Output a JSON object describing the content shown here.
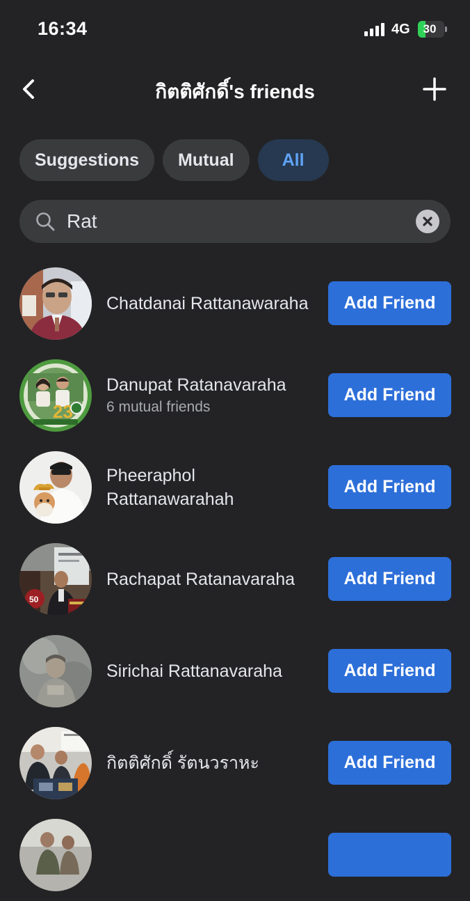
{
  "status_bar": {
    "time": "16:34",
    "network": "4G",
    "battery": "30",
    "battery_level": 0.3,
    "battery_color": "#30d158"
  },
  "nav": {
    "back_icon": "chevron-left-icon",
    "title": "กิตติศักดิ์'s friends",
    "add_icon": "plus-icon"
  },
  "tabs": [
    {
      "label": "Suggestions",
      "active": false
    },
    {
      "label": "Mutual",
      "active": false
    },
    {
      "label": "All",
      "active": true
    }
  ],
  "search": {
    "value": "Rat",
    "icon": "search-icon",
    "clear_icon": "close-circle-icon"
  },
  "friends": [
    {
      "name": "Chatdanai Rattanawaraha",
      "sub": "",
      "action": "Add Friend"
    },
    {
      "name": "Danupat Ratanavaraha",
      "sub": "6 mutual friends",
      "action": "Add Friend"
    },
    {
      "name": "Pheeraphol Rattanawarahah",
      "sub": "",
      "action": "Add Friend"
    },
    {
      "name": "Rachapat Ratanavaraha",
      "sub": "",
      "action": "Add Friend"
    },
    {
      "name": "Sirichai Rattanavaraha",
      "sub": "",
      "action": "Add Friend"
    },
    {
      "name": "กิตติศักดิ์ รัตนวราหะ",
      "sub": "",
      "action": "Add Friend"
    },
    {
      "name": "",
      "sub": "",
      "action": ""
    }
  ],
  "colors": {
    "background": "#232325",
    "accent": "#2d6fd9",
    "active_tab_bg": "#263951",
    "active_tab_text": "#5fa3f5"
  }
}
